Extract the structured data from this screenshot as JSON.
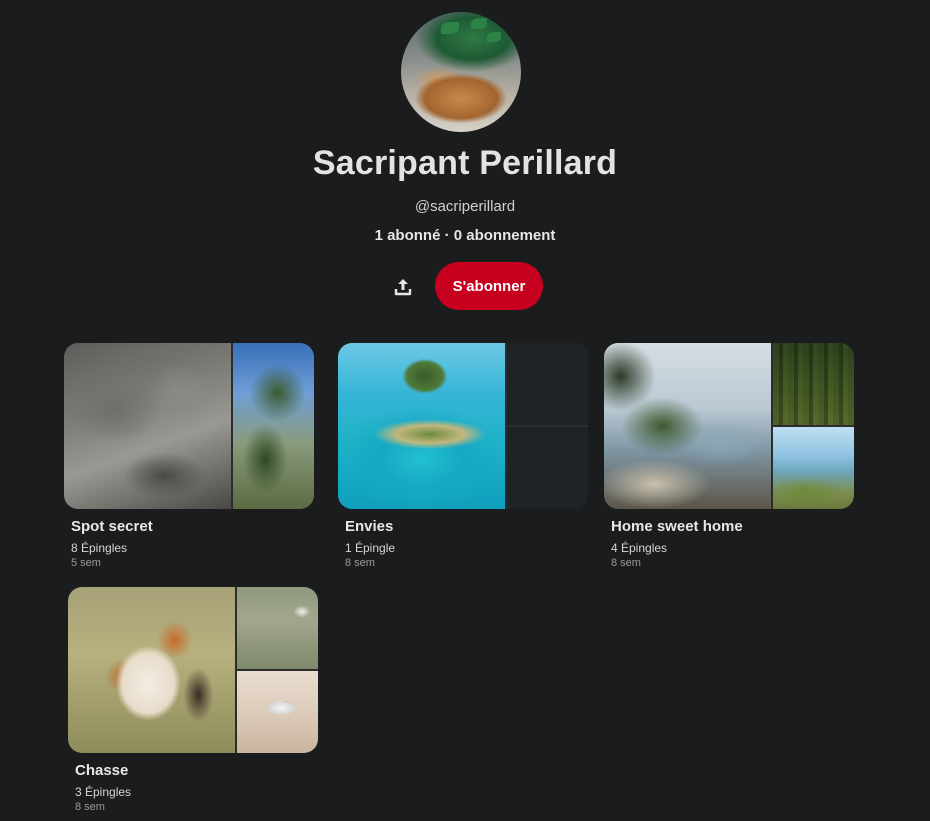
{
  "profile": {
    "name": "Sacripant Perillard",
    "handle": "@sacriperillard",
    "stats": "1 abonné · 0 abonnement",
    "avatar_icon": "dog-avatar",
    "follow_label": "S'abonner",
    "follow_color": "#c8001f",
    "share_icon": "share-upload-icon"
  },
  "boards": [
    {
      "title": "Spot secret",
      "pins": "8 Épingles",
      "age": "5 sem"
    },
    {
      "title": "Envies",
      "pins": "1 Épingle",
      "age": "8 sem"
    },
    {
      "title": "Home sweet home",
      "pins": "4 Épingles",
      "age": "8 sem"
    },
    {
      "title": "Chasse",
      "pins": "3 Épingles",
      "age": "8 sem"
    }
  ],
  "colors": {
    "background": "#1b1c1e",
    "accent": "#c8001f"
  }
}
